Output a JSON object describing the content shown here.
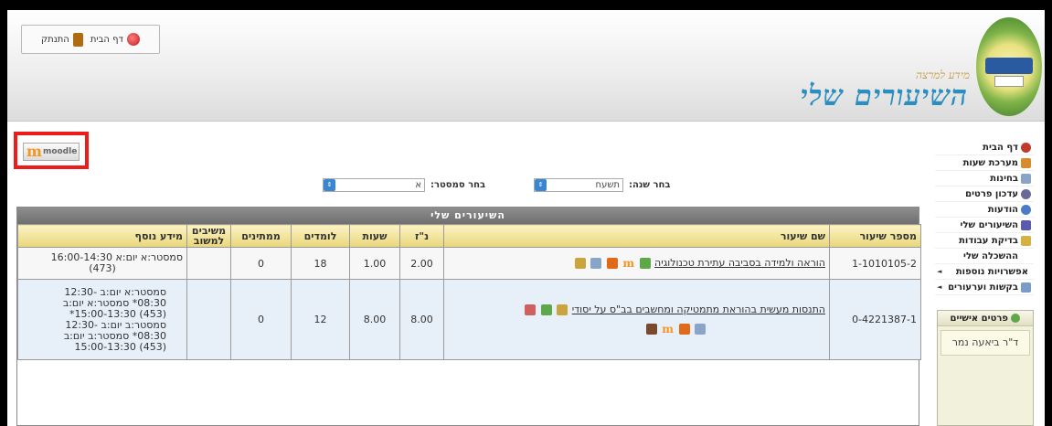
{
  "header": {
    "top_links": [
      {
        "label": "דף הבית",
        "icon": "home-icon"
      },
      {
        "label": "התנתק",
        "icon": "logout-icon"
      }
    ],
    "site_subtitle": "מידע למרצה",
    "site_title": "השיעורים שלי"
  },
  "moodle": {
    "m": "m",
    "text": "moodle"
  },
  "filters": {
    "year_label": "בחר שנה:",
    "year_value": "תשעח",
    "semester_label": "בחר סמסטר:",
    "semester_value": "א"
  },
  "table": {
    "title": "השיעורים שלי",
    "headers": {
      "number": "מספר שיעור",
      "name": "שם שיעור",
      "credits": "נ\"ז",
      "hours": "שעות",
      "students": "לומדים",
      "waiting": "ממתינים",
      "respondents": "משיבים למשוב",
      "extra": "מידע נוסף"
    },
    "rows": [
      {
        "number": "1-1010105-2",
        "name": "הוראה ולמידה בסביבה עתירת טכנולוגיה",
        "credits": "2.00",
        "hours": "1.00",
        "students": "18",
        "waiting": "0",
        "respondents": "",
        "extra": [
          "סמסטר:א יום:א 16:00-14:30",
          "(473)"
        ]
      },
      {
        "number": "0-4221387-1",
        "name": "התנסות מעשית בהוראת מתמטיקה ומחשבים בב\"ס על יסודי",
        "credits": "8.00",
        "hours": "8.00",
        "students": "12",
        "waiting": "0",
        "respondents": "",
        "extra": [
          "סמסטר:א יום:ב -12:30",
          "08:30* סמסטר:א יום:ב",
          "(453) 15:00-13:30*",
          "סמסטר:ב יום:ב -12:30",
          "08:30* סמסטר:ב יום:ב",
          "(453) 15:00-13:30"
        ]
      }
    ]
  },
  "sidebar": {
    "items": [
      {
        "label": "דף הבית",
        "color": "#c0392b",
        "arrow": ""
      },
      {
        "label": "מערכת שעות",
        "color": "#d98b2b",
        "arrow": ""
      },
      {
        "label": "בחינות",
        "color": "#8aa4c8",
        "arrow": ""
      },
      {
        "label": "עדכון פרטים",
        "color": "#6a6a9a",
        "arrow": ""
      },
      {
        "label": "הודעות",
        "color": "#4a7ac8",
        "arrow": ""
      },
      {
        "label": "השיעורים שלי",
        "color": "#5a5ab0",
        "arrow": ""
      },
      {
        "label": "בדיקת עבודות",
        "color": "#d8b040",
        "arrow": ""
      },
      {
        "label": "ההשכלה שלי",
        "color": "#ffffff",
        "arrow": ""
      },
      {
        "label": "אפשרויות נוספות",
        "color": "#ffffff",
        "arrow": "◄"
      },
      {
        "label": "בקשות וערעורים",
        "color": "#7a9ac8",
        "arrow": "◄"
      }
    ],
    "personal_title": "פרטים אישיים",
    "personal_name": "ד\"ר ביאעה נמר"
  }
}
